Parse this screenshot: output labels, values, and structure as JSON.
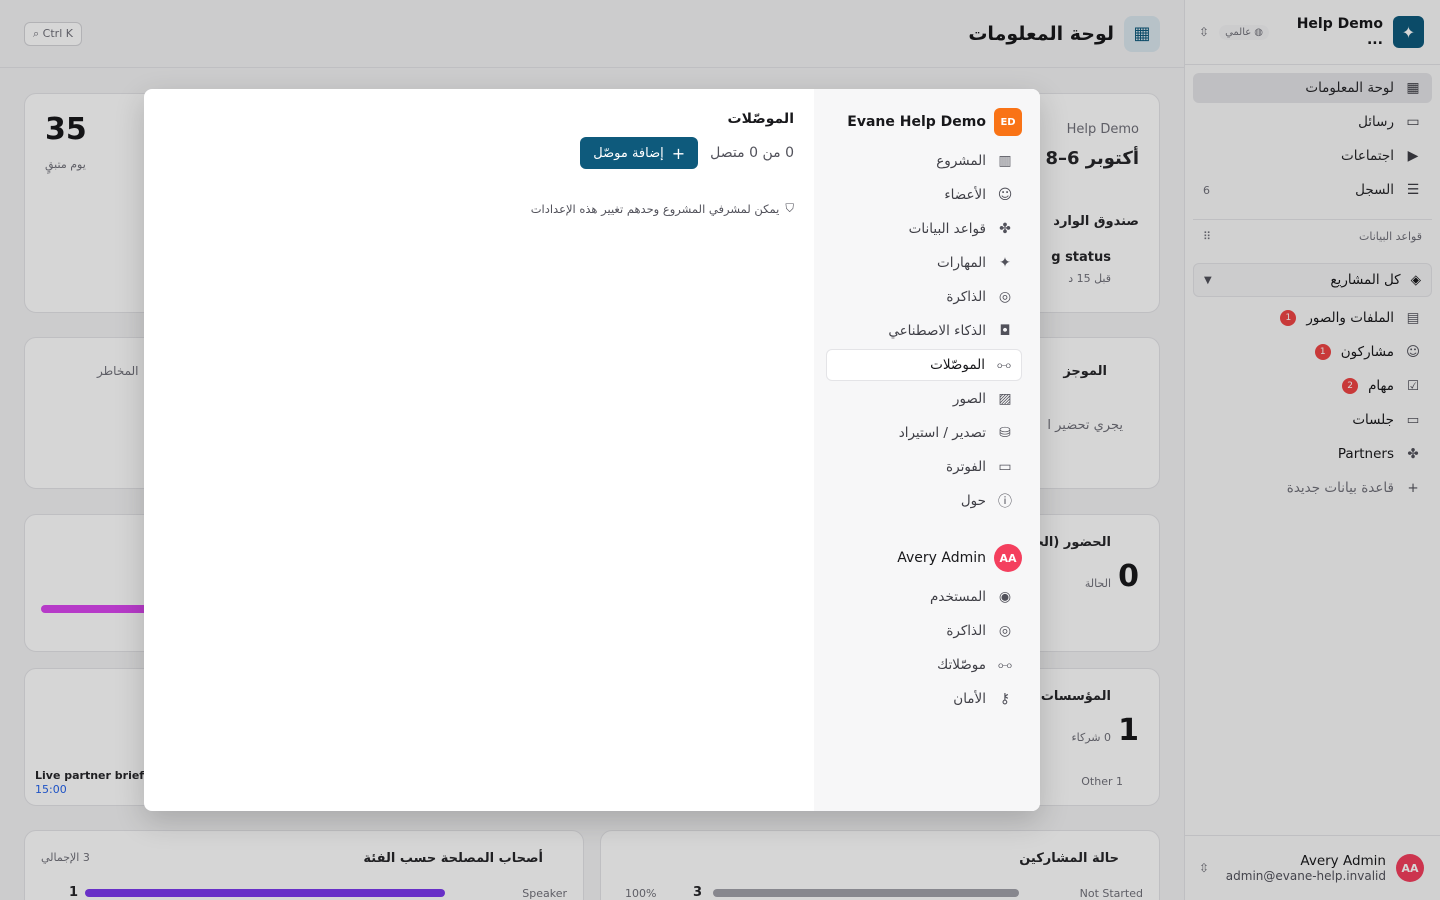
{
  "sidebar": {
    "workspace_name": "Help Demo ...",
    "workspace_scope": "عالمي",
    "nav": [
      {
        "label": "لوحة المعلومات",
        "count": ""
      },
      {
        "label": "رسائل",
        "count": ""
      },
      {
        "label": "اجتماعات",
        "count": ""
      },
      {
        "label": "السجل",
        "count": "6"
      }
    ],
    "databases_title": "قواعد البيانات",
    "all_projects": "كل المشاريع",
    "databases": [
      {
        "label": "الملفات والصور",
        "badge": "1"
      },
      {
        "label": "مشاركون",
        "badge": "1"
      },
      {
        "label": "مهام",
        "badge": "2"
      },
      {
        "label": "جلسات",
        "badge": ""
      },
      {
        "label": "Partners",
        "badge": ""
      }
    ],
    "new_database": "قاعدة بيانات جديدة",
    "user": {
      "initials": "AA",
      "name": "Avery Admin",
      "email": "admin@evane-help.invalid"
    }
  },
  "main": {
    "title": "لوحة المعلومات",
    "shortcut": "Ctrl K",
    "bg": {
      "days_left": "35",
      "days_label": "يوم متبقٍ",
      "project_label": "Help Demo",
      "dates": "أكتوبر 6–8",
      "inbox": "صندوق الوارد",
      "status": "g status",
      "status_time": "قبل 15 د",
      "brief": "الموجز",
      "brief_text": "يجري تحضير ا",
      "risks": "المخاطر",
      "attendance": "الحضور (الجمه",
      "attendance_value": "0",
      "attendance_label": "الحالة",
      "orgs": "المؤسسات",
      "orgs_value": "1",
      "orgs_sub": "0 شركاء",
      "orgs_other": "1 Other",
      "session_name": "Live partner briefi",
      "session_time": "15:00",
      "stakeholders": "أصحاب المصلحة حسب الفئة",
      "stakeholders_total": "3 الإجمالي",
      "stake_row_label": "Speaker",
      "stake_row_value": "1",
      "participants": "حالة المشاركين",
      "part_row_label": "Not Started",
      "part_row_value": "3",
      "part_row_pct": "100%"
    }
  },
  "modal": {
    "project": {
      "initials": "ED",
      "name": "Evane Help Demo"
    },
    "project_items": [
      {
        "label": "المشروع",
        "icon": "building-icon"
      },
      {
        "label": "الأعضاء",
        "icon": "users-icon"
      },
      {
        "label": "قواعد البيانات",
        "icon": "databases-icon"
      },
      {
        "label": "المهارات",
        "icon": "sparkles-icon"
      },
      {
        "label": "الذاكرة",
        "icon": "brain-icon"
      },
      {
        "label": "الذكاء الاصطناعي",
        "icon": "bot-icon"
      },
      {
        "label": "الموصّلات",
        "icon": "connectors-icon"
      },
      {
        "label": "الصور",
        "icon": "images-icon"
      },
      {
        "label": "تصدير / استيراد",
        "icon": "database-export-icon"
      },
      {
        "label": "الفوترة",
        "icon": "credit-card-icon"
      },
      {
        "label": "حول",
        "icon": "info-icon"
      }
    ],
    "user": {
      "initials": "AA",
      "name": "Avery Admin"
    },
    "user_items": [
      {
        "label": "المستخدم",
        "icon": "user-circle-icon"
      },
      {
        "label": "الذاكرة",
        "icon": "brain-icon"
      },
      {
        "label": "موصّلاتك",
        "icon": "connectors-icon"
      },
      {
        "label": "الأمان",
        "icon": "key-icon"
      }
    ],
    "content": {
      "title": "الموصّلات",
      "add_button": "إضافة موصّل",
      "count": "0 من 0 متصل",
      "note": "يمكن لمشرفي المشروع وحدهم تغيير هذه الإعدادات"
    }
  }
}
